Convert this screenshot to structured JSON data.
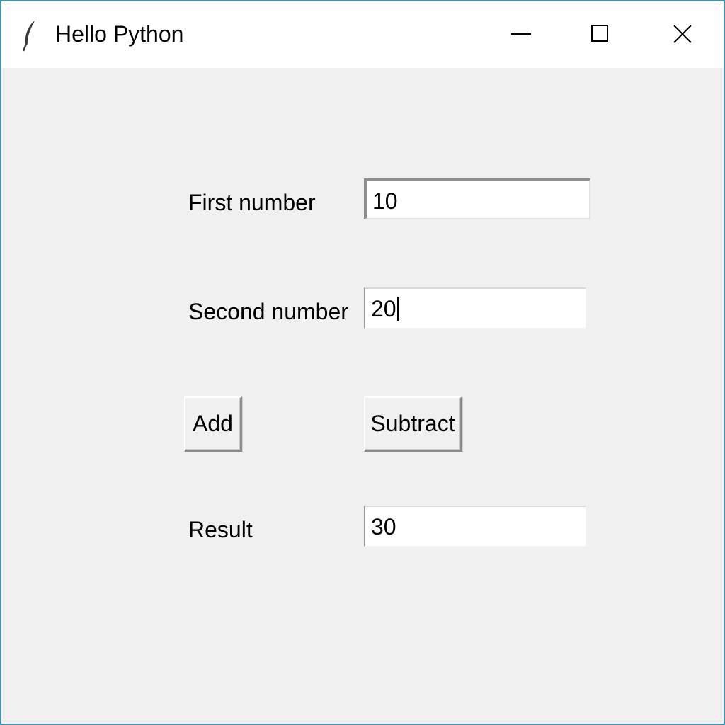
{
  "window": {
    "title": "Hello Python",
    "icon": "feather-icon",
    "controls": {
      "minimize_icon": "minimize-icon",
      "maximize_icon": "maximize-icon",
      "close_icon": "close-icon"
    }
  },
  "form": {
    "first_label": "First number",
    "first_value": "10",
    "second_label": "Second number",
    "second_value": "20",
    "add_label": "Add",
    "subtract_label": "Subtract",
    "result_label": "Result",
    "result_value": "30"
  },
  "colors": {
    "window_border": "#4a90a8",
    "background": "#f0f0f0",
    "entry_background": "#ffffff"
  }
}
